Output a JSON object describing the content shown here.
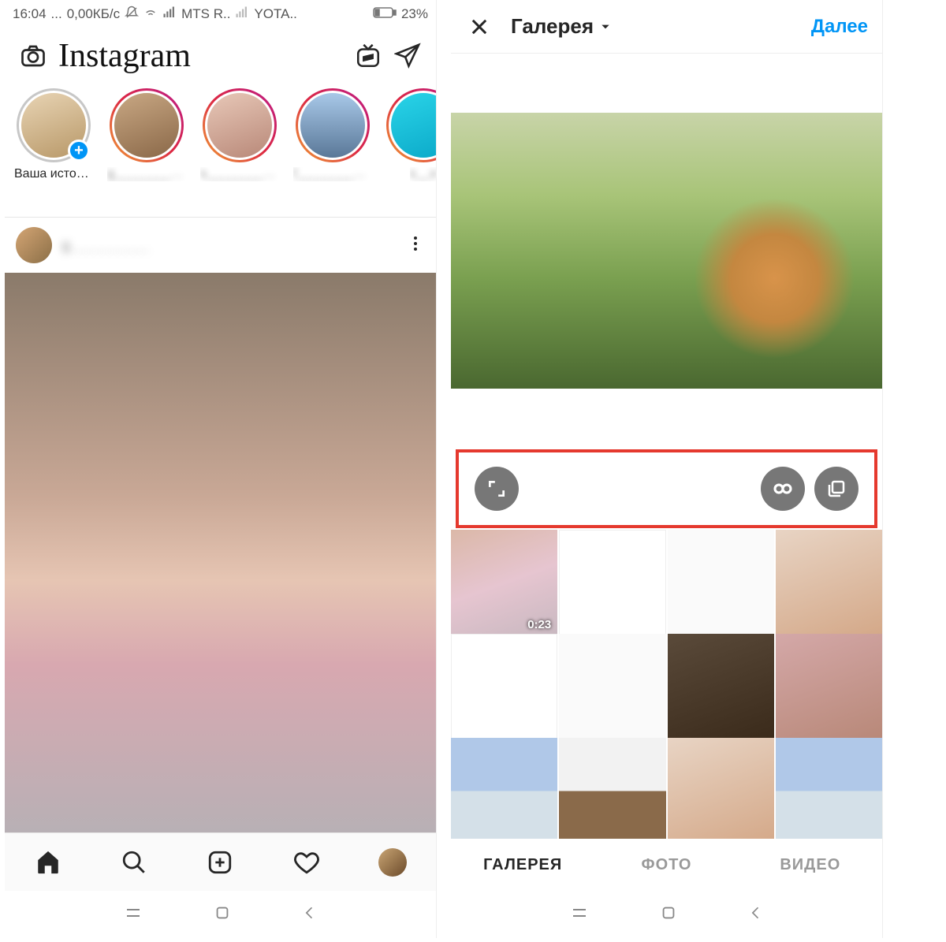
{
  "status_bar": {
    "time": "16:04",
    "dots": "...",
    "speed": "0,00КБ/с",
    "carrier1": "MTS R..",
    "carrier2": "YOTA..",
    "battery": "23%"
  },
  "left": {
    "logo": "Instagram",
    "stories": [
      {
        "label": "Ваша истор...",
        "self": true
      },
      {
        "label": "g________mar..",
        "self": false
      },
      {
        "label": "s_________ka",
        "self": false
      },
      {
        "label": "f_________on",
        "self": false
      },
      {
        "label": "s__o",
        "self": false
      }
    ],
    "post_user": "g__________"
  },
  "right": {
    "header": {
      "title": "Галерея",
      "next": "Далее"
    },
    "thumbs": [
      {
        "duration": "0:23"
      }
    ],
    "tabs": {
      "gallery": "ГАЛЕРЕЯ",
      "photo": "ФОТО",
      "video": "ВИДЕО"
    }
  }
}
